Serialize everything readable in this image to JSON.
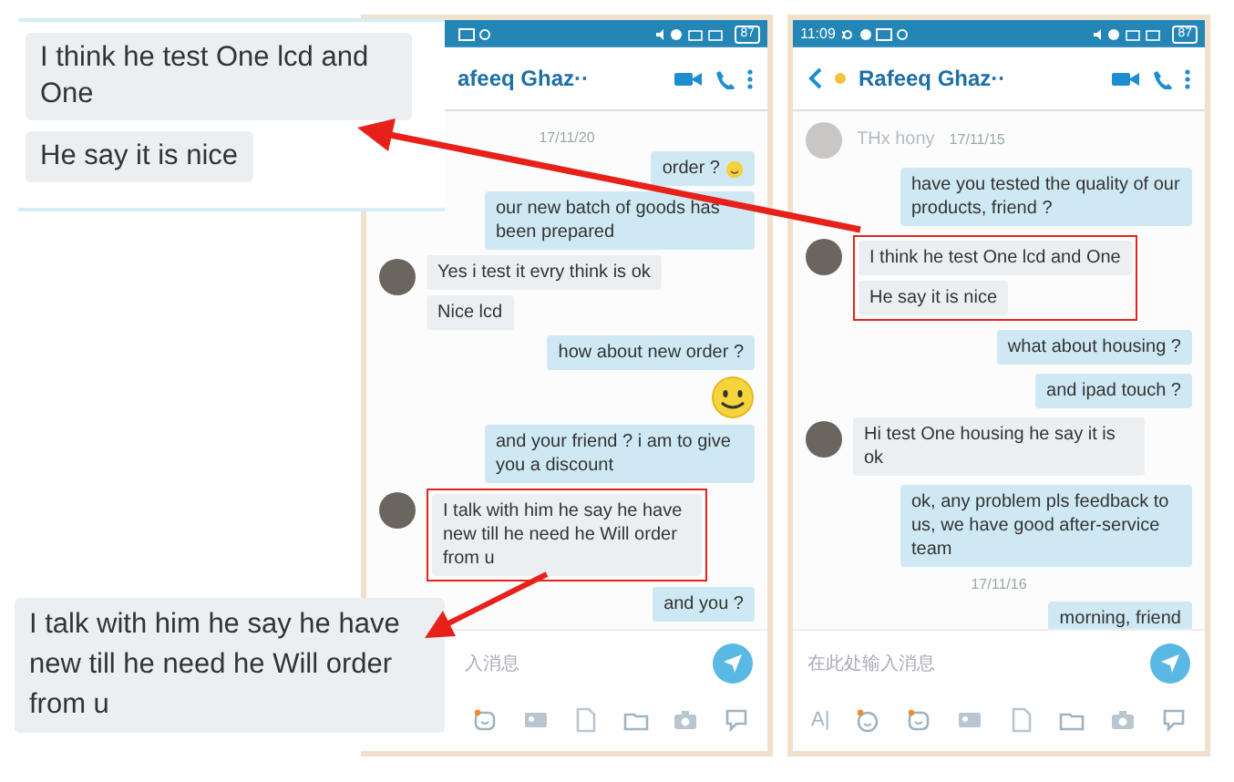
{
  "phones": [
    {
      "cropped_left": true,
      "status_bar": {
        "battery": "87"
      },
      "header": {
        "name": "afeeq Ghaz··"
      },
      "messages": [
        {
          "kind": "date",
          "text": "17/11/20"
        },
        {
          "kind": "outgoing_emoji",
          "text": "order ?"
        },
        {
          "kind": "outgoing",
          "text": "our new batch of goods has been prepared"
        },
        {
          "kind": "incoming",
          "highlighted": false,
          "bubbles": [
            "Yes i test it evry think is ok",
            "Nice lcd"
          ]
        },
        {
          "kind": "outgoing",
          "text": "how about new order ?"
        },
        {
          "kind": "sticker"
        },
        {
          "kind": "outgoing",
          "text": "and your friend ? i am to give you a discount"
        },
        {
          "kind": "incoming",
          "highlighted": true,
          "bubbles": [
            "I talk with him he say he have new till he need he Will order from u"
          ]
        },
        {
          "kind": "outgoing",
          "text": "and you ?"
        }
      ],
      "input": {
        "placeholder": "入消息"
      }
    },
    {
      "cropped_left": false,
      "status_bar": {
        "time": "11:09",
        "battery": "87"
      },
      "header": {
        "name": "Rafeeq Ghaz··"
      },
      "messages": [
        {
          "kind": "faded",
          "text": "THx hony",
          "date": "17/11/15"
        },
        {
          "kind": "outgoing",
          "text": "have you  tested the quality of our products, friend ?"
        },
        {
          "kind": "incoming",
          "highlighted": true,
          "bubbles": [
            "I think he test One lcd and One",
            "He say it is nice"
          ]
        },
        {
          "kind": "outgoing",
          "text": "what about housing ?"
        },
        {
          "kind": "outgoing",
          "text": "and ipad touch ?"
        },
        {
          "kind": "incoming",
          "highlighted": false,
          "bubbles": [
            "Hi test One housing he say it is ok"
          ]
        },
        {
          "kind": "outgoing",
          "text": "ok, any problem pls feedback to us, we have good after-service team"
        },
        {
          "kind": "date",
          "text": "17/11/16"
        },
        {
          "kind": "outgoing",
          "text": "morning, friend"
        }
      ],
      "input": {
        "placeholder": "在此处输入消息",
        "format_glyph": "A|"
      }
    }
  ],
  "callouts": [
    {
      "bubbles": [
        "I think he test One lcd and One",
        "He say it is nice"
      ]
    },
    {
      "bubbles": [
        "I talk with him he say he have new till he need he Will order from u"
      ]
    }
  ]
}
